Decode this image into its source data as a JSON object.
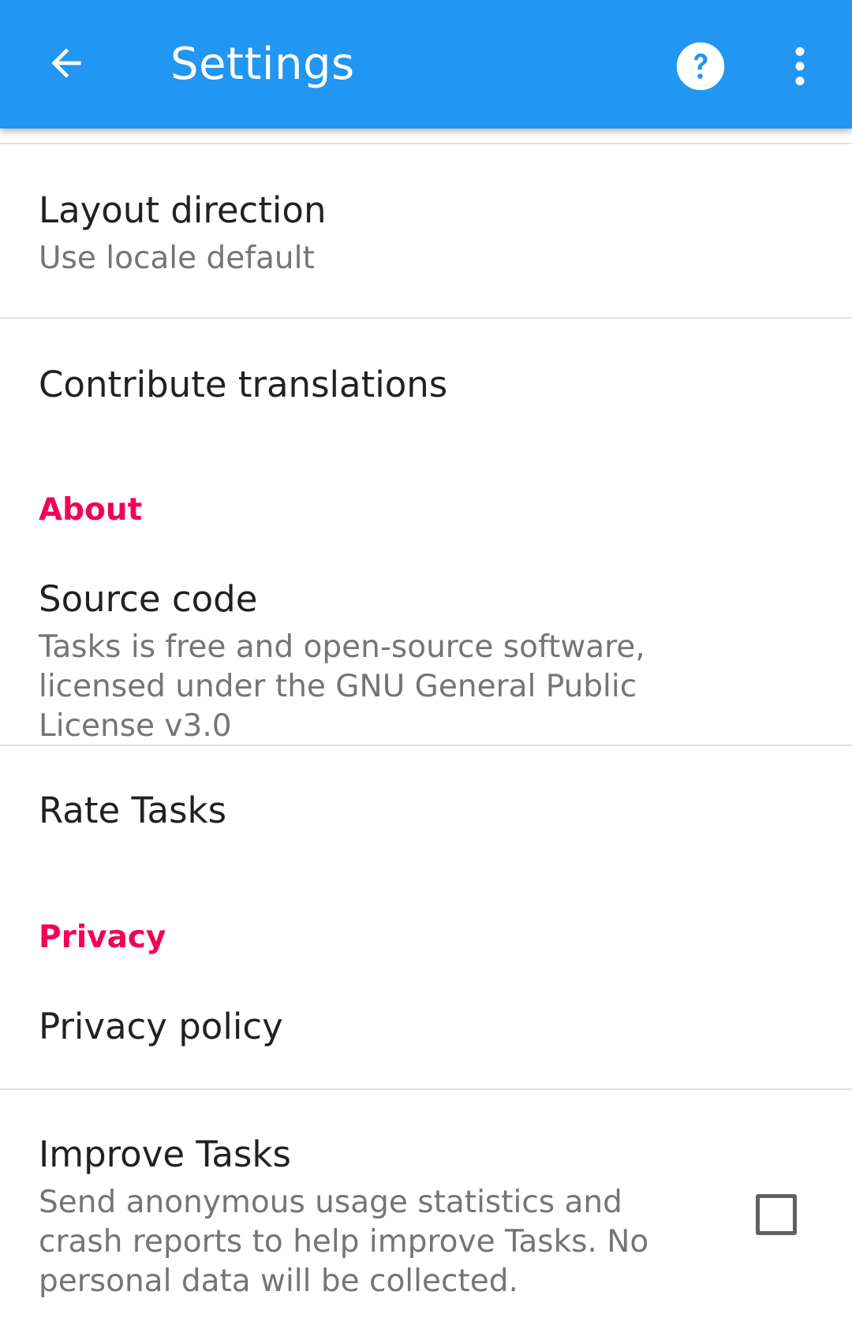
{
  "toolbar": {
    "title": "Settings",
    "back_icon": "arrow-left-icon",
    "help_icon": "help-circle-icon",
    "more_icon": "more-vertical-icon",
    "color": "#2196F3"
  },
  "items": {
    "layout_direction": {
      "title": "Layout direction",
      "summary": "Use locale default"
    },
    "contribute_translations": {
      "title": "Contribute translations"
    },
    "source_code": {
      "title": "Source code",
      "summary": "Tasks is free and open-source software, licensed under the GNU General Public License v3.0"
    },
    "rate_tasks": {
      "title": "Rate Tasks"
    },
    "privacy_policy": {
      "title": "Privacy policy"
    },
    "improve_tasks": {
      "title": "Improve Tasks",
      "summary": "Send anonymous usage statistics and crash reports to help improve Tasks. No personal data will be collected.",
      "checked": false
    }
  },
  "headers": {
    "about": "About",
    "privacy": "Privacy"
  },
  "colors": {
    "accent": "#F50057",
    "primary_text": "#212121",
    "secondary_text": "#757575"
  }
}
